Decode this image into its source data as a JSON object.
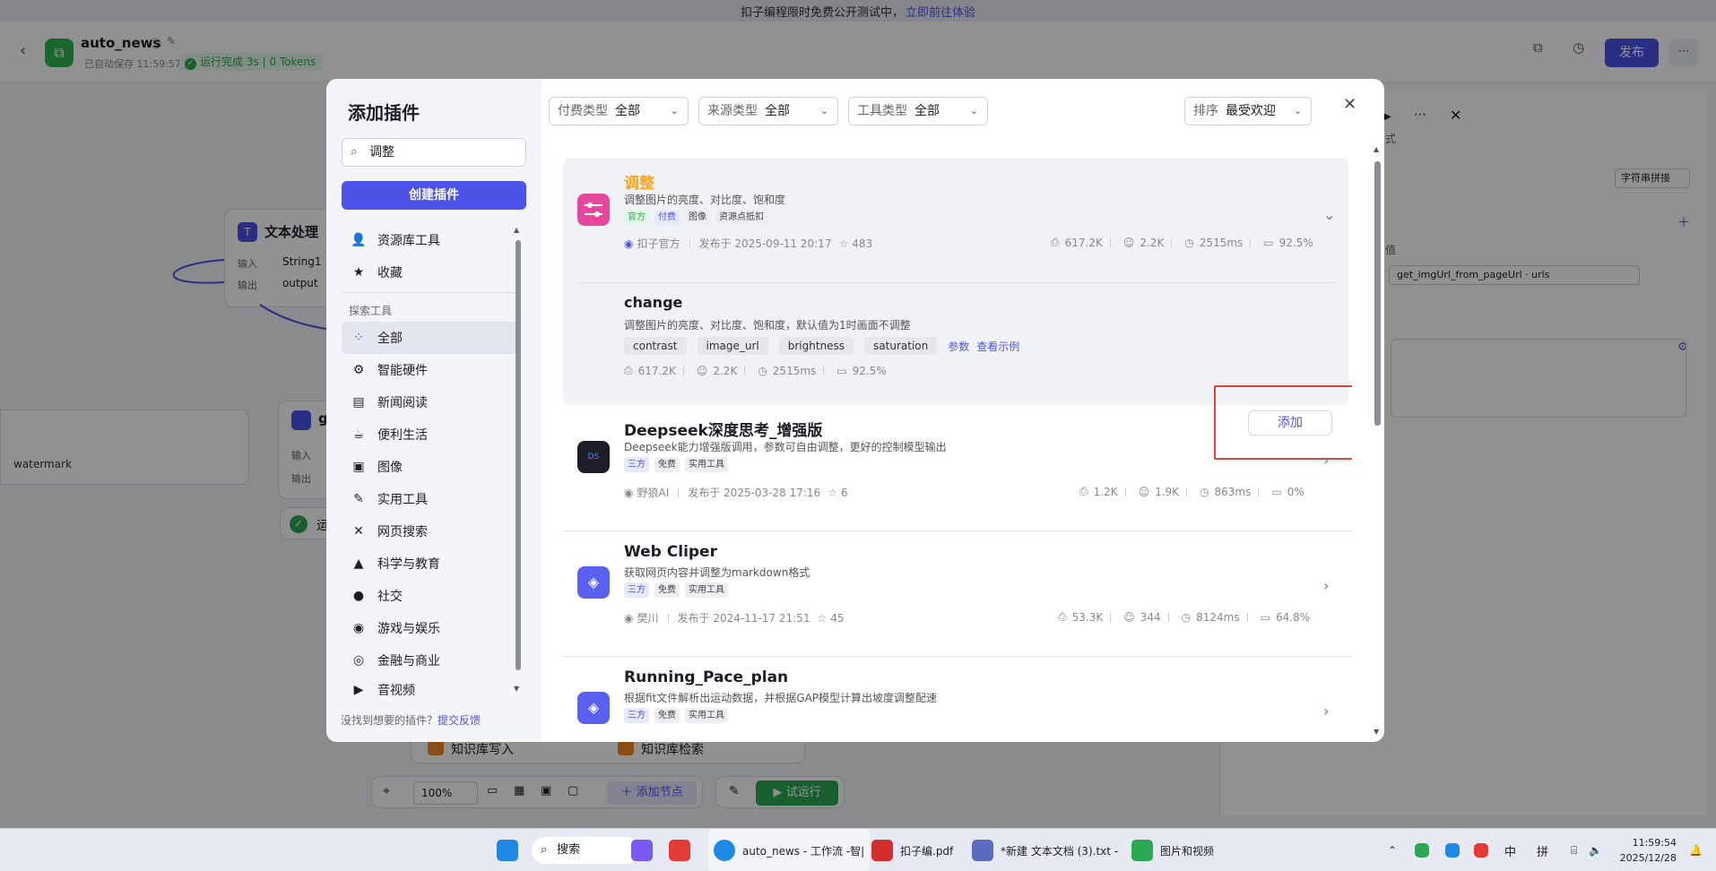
{
  "banner": {
    "text": "扣子编程限时免费公开测试中，",
    "link": "立即前往体验"
  },
  "header": {
    "app_name": "auto_news",
    "saved": "已自动保存 11:59:57",
    "run_status": "运行完成 3s | 0 Tokens",
    "publish_label": "发布"
  },
  "canvas": {
    "node1_title": "文本处理",
    "node1_in_label": "输入",
    "node1_in_value": "String1",
    "node1_out_label": "输出",
    "node1_out_value": "output",
    "node2_title": "g",
    "node2_in_label": "输入",
    "node2_out_label": "输出",
    "left_value": "watermark",
    "kb_write": "知识库写入",
    "kb_search": "知识库检索",
    "zoom": "100%",
    "add_node": "添加节点",
    "trial_run": "试运行",
    "running_prefix": "运"
  },
  "right_panel": {
    "format_label": "式",
    "dropdown_label": "字符串拼接",
    "value_label": "值",
    "var_ref": "get_imgUrl_from_pageUrl · urls"
  },
  "modal": {
    "title": "添加插件",
    "search_value": "调整",
    "create_label": "创建插件",
    "sidebar_items": [
      {
        "label": "资源库工具",
        "icon": "toolbox-icon",
        "glyph": "👤"
      },
      {
        "label": "收藏",
        "icon": "star-icon",
        "glyph": "★"
      }
    ],
    "explore_group": "探索工具",
    "explore_items": [
      {
        "label": "全部",
        "icon": "grid-icon",
        "glyph": "⁘"
      },
      {
        "label": "智能硬件",
        "icon": "chip-icon",
        "glyph": "⚙"
      },
      {
        "label": "新闻阅读",
        "icon": "newspaper-icon",
        "glyph": "▤"
      },
      {
        "label": "便利生活",
        "icon": "coffee-icon",
        "glyph": "☕"
      },
      {
        "label": "图像",
        "icon": "image-icon",
        "glyph": "▣"
      },
      {
        "label": "实用工具",
        "icon": "wrench-icon",
        "glyph": "✎"
      },
      {
        "label": "网页搜索",
        "icon": "network-icon",
        "glyph": "✕"
      },
      {
        "label": "科学与教育",
        "icon": "graduation-icon",
        "glyph": "▲"
      },
      {
        "label": "社交",
        "icon": "chat-icon",
        "glyph": "●"
      },
      {
        "label": "游戏与娱乐",
        "icon": "gamepad-icon",
        "glyph": "◉"
      },
      {
        "label": "金融与商业",
        "icon": "coins-icon",
        "glyph": "◎"
      },
      {
        "label": "音视频",
        "icon": "video-icon",
        "glyph": "▶"
      }
    ],
    "feedback_text": "没找到想要的插件？",
    "feedback_link": "提交反馈",
    "filters": {
      "pay_label": "付费类型",
      "pay_value": "全部",
      "source_label": "来源类型",
      "source_value": "全部",
      "tool_label": "工具类型",
      "tool_value": "全部",
      "sort_label": "排序",
      "sort_value": "最受欢迎"
    },
    "plugins": [
      {
        "name": "调整",
        "desc": "调整图片的亮度、对比度、饱和度",
        "tags": [
          "官方",
          "付费",
          "图像",
          "资源点抵扣"
        ],
        "author": "扣子官方",
        "published": "发布于 2025-09-11 20:17",
        "stars": "483",
        "stats": [
          "617.2K",
          "2.2K",
          "2515ms",
          "92.5%"
        ]
      },
      {
        "tool_name": "change",
        "tool_desc": "调整图片的亮度、对比度、饱和度，默认值为1时画面不调整",
        "params": [
          "contrast",
          "image_url",
          "brightness",
          "saturation"
        ],
        "params_link": "参数",
        "example_link": "查看示例",
        "stats": [
          "617.2K",
          "2.2K",
          "2515ms",
          "92.5%"
        ],
        "add_label": "添加"
      },
      {
        "name": "Deepseek深度思考_增强版",
        "desc": "Deepseek能力增强版调用，参数可自由调整，更好的控制模型输出",
        "tags": [
          "三方",
          "免费",
          "实用工具"
        ],
        "author": "野狼AI",
        "published": "发布于 2025-03-28 17:16",
        "stars": "6",
        "stats": [
          "1.2K",
          "1.9K",
          "863ms",
          "0%"
        ]
      },
      {
        "name": "Web Cliper",
        "desc": "获取网页内容并调整为markdown格式",
        "tags": [
          "三方",
          "免费",
          "实用工具"
        ],
        "author": "樊川",
        "published": "发布于 2024-11-17 21:51",
        "stars": "45",
        "stats": [
          "53.3K",
          "344",
          "8124ms",
          "64.8%"
        ]
      },
      {
        "name": "Running_Pace_plan",
        "desc": "根据fit文件解析出运动数据，并根据GAP模型计算出坡度调整配速",
        "tags": [
          "三方",
          "免费",
          "实用工具"
        ]
      }
    ]
  },
  "taskbar": {
    "search": "搜索",
    "edge_title": "auto_news - 工作流 -智|",
    "pdf_title": "扣子编.pdf",
    "notepad_title": "*新建 文本文档 (3).txt -",
    "wechat_title": "图片和视频",
    "ime1": "中",
    "ime2": "拼",
    "time": "11:59:54",
    "date": "2025/12/28"
  },
  "colors": {
    "accent": "#4d53e8",
    "success": "#2aa952",
    "highlight_box": "#e5423b",
    "plugin_title_orange": "#f5a623"
  }
}
